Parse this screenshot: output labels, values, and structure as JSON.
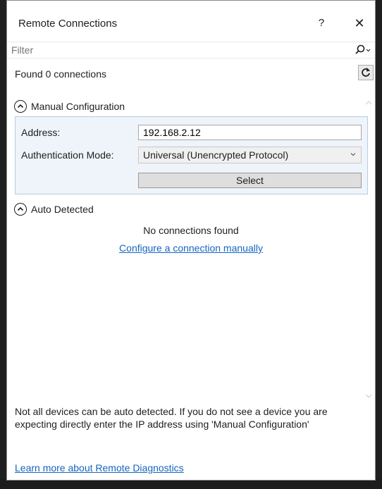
{
  "window": {
    "title": "Remote Connections",
    "help_label": "?",
    "close_label": "✕"
  },
  "filter": {
    "placeholder": "Filter",
    "value": ""
  },
  "status": {
    "found_text": "Found 0 connections"
  },
  "manual": {
    "header": "Manual Configuration",
    "address_label": "Address:",
    "address_value": "192.168.2.12",
    "auth_label": "Authentication Mode:",
    "auth_value": "Universal (Unencrypted Protocol)",
    "select_label": "Select"
  },
  "auto": {
    "header": "Auto Detected",
    "empty_text": "No connections found",
    "configure_link": "Configure a connection manually"
  },
  "footer": {
    "info_text": "Not all devices can be auto detected. If you do not see a device you are expecting directly enter the IP address using 'Manual Configuration'",
    "learn_link": "Learn more about Remote Diagnostics"
  },
  "colors": {
    "panel_bg": "#eef4fa",
    "panel_border": "#b9cde2",
    "link": "#1565c0"
  }
}
